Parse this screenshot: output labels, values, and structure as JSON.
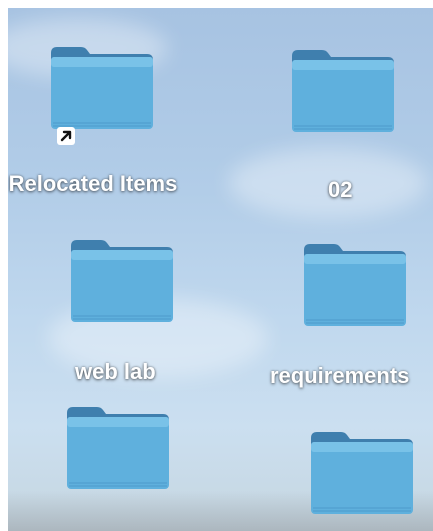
{
  "desktop": {
    "items": [
      {
        "label": "Relocated Items",
        "icon": "folder-alias-icon"
      },
      {
        "label": "02",
        "icon": "folder-icon"
      },
      {
        "label": "web lab",
        "icon": "folder-icon"
      },
      {
        "label": "requirements",
        "icon": "folder-icon"
      },
      {
        "label": "",
        "icon": "folder-icon"
      },
      {
        "label": "",
        "icon": "folder-icon"
      }
    ]
  },
  "colors": {
    "folder_body": "#5fb0dd",
    "folder_tab": "#4a8fbd",
    "folder_back": "#3f7fae",
    "label_text": "#ffffff"
  }
}
